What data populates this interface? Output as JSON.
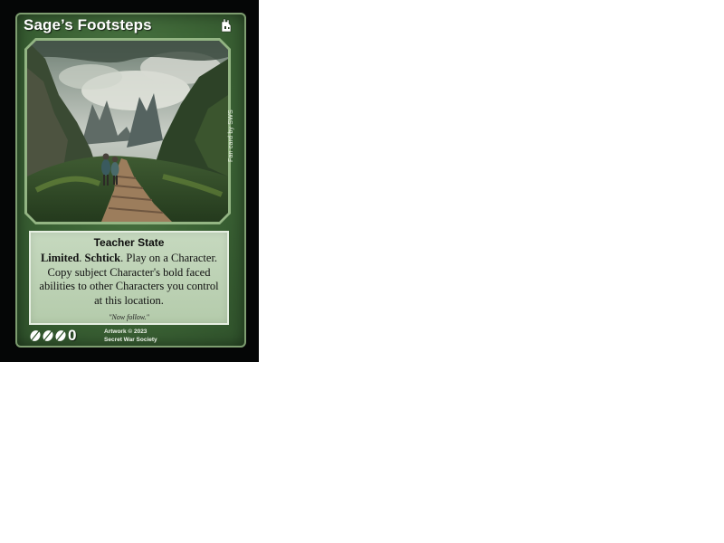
{
  "card": {
    "title": "Sage’s Footsteps",
    "type_icon": "tower-icon",
    "side_text": "Fan card by SWS",
    "ability_name": "Teacher State",
    "keyword_1": "Limited",
    "keyword_2": "Schtick",
    "rules_text_1": "Play on a Character.",
    "rules_text_2": "Copy subject Character's bold faced abilities to other Characters you control at this location.",
    "flavor_text": "\"Now follow.\"",
    "cost_icons": [
      "feather-icon",
      "feather-icon",
      "feather-icon"
    ],
    "cost_value": "0",
    "credit_line_1": "Artwork © 2023",
    "credit_line_2": "Secret War Society",
    "colors": {
      "card_green": "#3e6637",
      "text_box": "#c0d4b8",
      "border": "#050606"
    }
  }
}
